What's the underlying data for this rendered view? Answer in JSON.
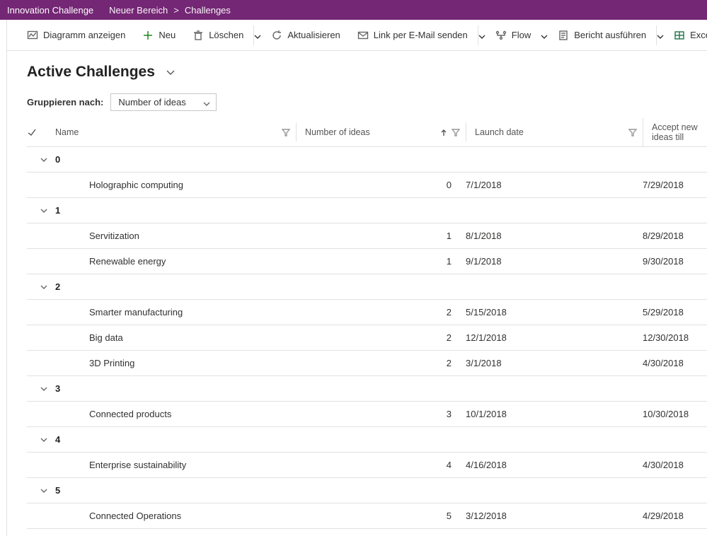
{
  "topbar": {
    "app_title": "Innovation Challenge",
    "crumb1": "Neuer Bereich",
    "crumb2": "Challenges"
  },
  "commands": {
    "chart": "Diagramm anzeigen",
    "new": "Neu",
    "delete": "Löschen",
    "refresh": "Aktualisieren",
    "email_link": "Link per E-Mail senden",
    "flow": "Flow",
    "run_report": "Bericht ausführen",
    "excel": "Excel-Vo"
  },
  "view": {
    "title": "Active Challenges",
    "group_by_label": "Gruppieren nach:",
    "group_by_value": "Number of ideas"
  },
  "columns": {
    "name": "Name",
    "ideas": "Number of ideas",
    "launch": "Launch date",
    "accept": "Accept new ideas till"
  },
  "groups": [
    {
      "label": "0",
      "rows": [
        {
          "name": "Holographic computing",
          "ideas": "0",
          "launch": "7/1/2018",
          "accept": "7/29/2018"
        }
      ]
    },
    {
      "label": "1",
      "rows": [
        {
          "name": "Servitization",
          "ideas": "1",
          "launch": "8/1/2018",
          "accept": "8/29/2018"
        },
        {
          "name": "Renewable energy",
          "ideas": "1",
          "launch": "9/1/2018",
          "accept": "9/30/2018"
        }
      ]
    },
    {
      "label": "2",
      "rows": [
        {
          "name": "Smarter manufacturing",
          "ideas": "2",
          "launch": "5/15/2018",
          "accept": "5/29/2018"
        },
        {
          "name": "Big data",
          "ideas": "2",
          "launch": "12/1/2018",
          "accept": "12/30/2018"
        },
        {
          "name": "3D Printing",
          "ideas": "2",
          "launch": "3/1/2018",
          "accept": "4/30/2018"
        }
      ]
    },
    {
      "label": "3",
      "rows": [
        {
          "name": "Connected products",
          "ideas": "3",
          "launch": "10/1/2018",
          "accept": "10/30/2018"
        }
      ]
    },
    {
      "label": "4",
      "rows": [
        {
          "name": "Enterprise sustainability",
          "ideas": "4",
          "launch": "4/16/2018",
          "accept": "4/30/2018"
        }
      ]
    },
    {
      "label": "5",
      "rows": [
        {
          "name": "Connected Operations",
          "ideas": "5",
          "launch": "3/12/2018",
          "accept": "4/29/2018"
        }
      ]
    }
  ]
}
